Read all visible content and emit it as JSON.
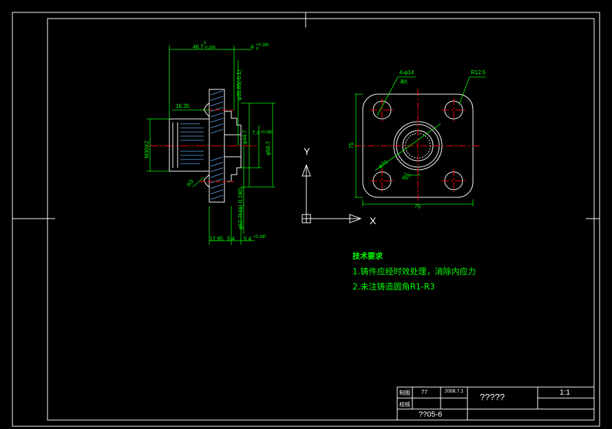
{
  "drawing": {
    "dimensions": {
      "d_46_7": "46.7",
      "d_46_7_tol": "-0.390",
      "d_46_7_tol_up": "0",
      "d_4": "4",
      "d_4_tol": "+0.180",
      "d_4_tol_low": "0",
      "d_16_35": "16.35",
      "d_m30x2": "M30X2",
      "d_r3": "R3",
      "d_phi35_85": "φ35.85(-0.1)",
      "d_phi30_7": "φ30.7",
      "d_phi44_7": "φ44.7",
      "d_phi56_7": "φ56.7",
      "d_7_4": "7.4",
      "d_7_4_tol": "+0.080",
      "d_phi52_7": "φ52.7h11(-0.190)",
      "d_12_95": "12.95",
      "d_5_4": "5.4",
      "d_5_4b": "5.4",
      "d_5_4_tol": "+0.180",
      "d_4xphi14": "4-φ14",
      "d_through": "通孔",
      "d_r12_5": "R12.5",
      "d_75_v": "75",
      "d_75_h": "75",
      "d_phi70": "φ70",
      "d_45deg": "45°"
    },
    "ucs": {
      "y_label": "Y",
      "x_label": "X"
    }
  },
  "notes": {
    "title": "技术要求",
    "line1": "1.铸件应经时效处理，消除内应力",
    "line2": "2.未注铸造圆角R1-R3"
  },
  "title_block": {
    "drawn_label": "制图",
    "drawn_by": "77",
    "date": "2008.7.1",
    "checked_label": "校核",
    "part_name": "?????",
    "scale": "1:1",
    "drawing_no": "??05-6"
  },
  "colors": {
    "background": "#000000",
    "frame": "#ffffff",
    "section": "#ff0000",
    "centerline": "#ff0000",
    "dimension": "#00ff00",
    "hatch": "#00aaff"
  }
}
